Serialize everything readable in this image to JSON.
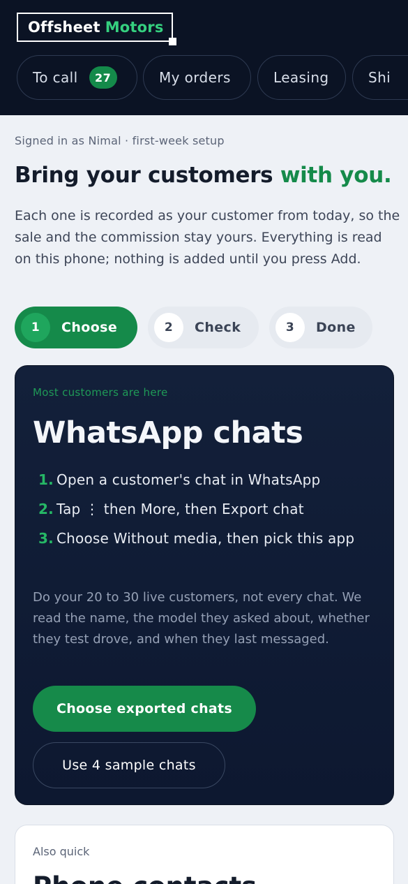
{
  "header": {
    "brand_word1": "Offsheet",
    "brand_word2": "Motors",
    "tabs": [
      {
        "label": "To call",
        "badge": "27"
      },
      {
        "label": "My orders"
      },
      {
        "label": "Leasing"
      },
      {
        "label": "Shi"
      }
    ]
  },
  "intro": {
    "signed_in": "Signed in as Nimal · first-week setup",
    "headline_main": "Bring your customers",
    "headline_accent": "with you.",
    "lede": "Each one is recorded as your customer from today, so the sale and the commission stay yours. Everything is read on this phone; nothing is added until you press Add."
  },
  "stepper": [
    {
      "num": "1",
      "label": "Choose",
      "state": "active"
    },
    {
      "num": "2",
      "label": "Check",
      "state": "idle"
    },
    {
      "num": "3",
      "label": "Done",
      "state": "idle"
    }
  ],
  "whatsapp_card": {
    "eyebrow": "Most customers are here",
    "title": "WhatsApp chats",
    "steps": [
      {
        "num": "1.",
        "text": "Open a customer's chat in WhatsApp"
      },
      {
        "num": "2.",
        "text": "Tap ⋮ then More, then Export chat"
      },
      {
        "num": "3.",
        "text": "Choose Without media, then pick this app"
      }
    ],
    "body": "Do your 20 to 30 live customers, not every chat. We read the name, the model they asked about, whether they test drove, and when they last messaged.",
    "primary_button": "Choose exported chats",
    "secondary_button": "Use 4 sample chats"
  },
  "second_card": {
    "eyebrow": "Also quick",
    "title": "Phone contacts"
  },
  "colors": {
    "header_bg": "#0b1324",
    "accent_green": "#158a4a",
    "brand_green": "#35d07f",
    "card_bg": "#13203a",
    "page_bg": "#eef1f6"
  }
}
